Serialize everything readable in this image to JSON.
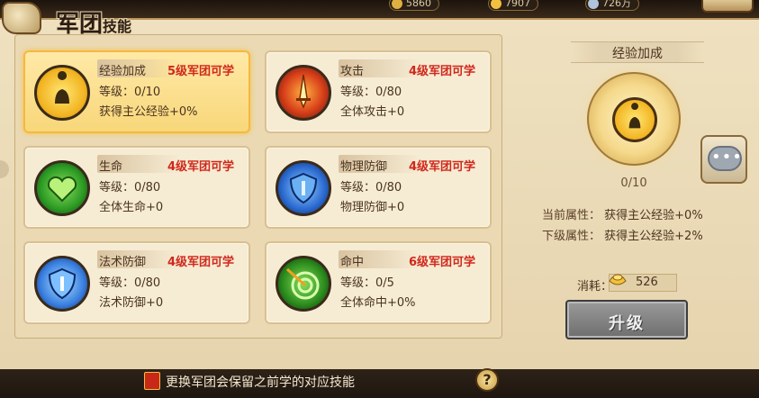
{
  "header": {
    "title_main": "军团",
    "title_sub": "技能",
    "resources": [
      {
        "value": "5860",
        "color": "#e0b040"
      },
      {
        "value": "7907",
        "color": "#f2c040"
      },
      {
        "value": "726万",
        "color": "#b0c4dc"
      }
    ]
  },
  "skills": [
    {
      "name": "经验加成",
      "requirement": "5级军团可学",
      "level": "等级：0/10",
      "effect": "获得主公经验+0%",
      "icon": "scholar-icon",
      "selected": true
    },
    {
      "name": "攻击",
      "requirement": "4级军团可学",
      "level": "等级：0/80",
      "effect": "全体攻击+0",
      "icon": "sword-icon",
      "selected": false
    },
    {
      "name": "生命",
      "requirement": "4级军团可学",
      "level": "等级：0/80",
      "effect": "全体生命+0",
      "icon": "heart-icon",
      "selected": false
    },
    {
      "name": "物理防御",
      "requirement": "4级军团可学",
      "level": "等级：0/80",
      "effect": "物理防御+0",
      "icon": "shield-icon",
      "selected": false
    },
    {
      "name": "法术防御",
      "requirement": "4级军团可学",
      "level": "等级：0/80",
      "effect": "法术防御+0",
      "icon": "magic-shield-icon",
      "selected": false
    },
    {
      "name": "命中",
      "requirement": "6级军团可学",
      "level": "等级：0/5",
      "effect": "全体命中+0%",
      "icon": "target-icon",
      "selected": false
    }
  ],
  "detail": {
    "title": "经验加成",
    "count": "0/10",
    "current_label": "当前属性：",
    "current_value": "获得主公经验+0%",
    "next_label": "下级属性：",
    "next_value": "获得主公经验+2%",
    "cost_label": "消耗：",
    "cost_value": "526",
    "upgrade_label": "升级"
  },
  "footer": {
    "notice": "更换军团会保留之前学的对应技能",
    "help": "?"
  },
  "colors": {
    "requirement": "#d0281c",
    "selected_card": "#f8d77a",
    "parchment": "#efe1c0"
  }
}
